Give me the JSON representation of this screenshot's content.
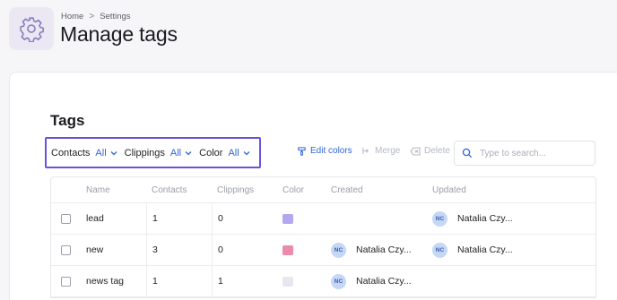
{
  "breadcrumb": {
    "home": "Home",
    "separator": ">",
    "current": "Settings"
  },
  "page": {
    "title": "Manage tags",
    "icon": "gear-icon"
  },
  "card": {
    "title": "Tags"
  },
  "filters": [
    {
      "label": "Contacts",
      "value": "All"
    },
    {
      "label": "Clippings",
      "value": "All"
    },
    {
      "label": "Color",
      "value": "All"
    }
  ],
  "toolbar": {
    "edit_colors": "Edit colors",
    "merge": "Merge",
    "delete": "Delete"
  },
  "search": {
    "placeholder": "Type to search..."
  },
  "table": {
    "columns": [
      "Name",
      "Contacts",
      "Clippings",
      "Color",
      "Created",
      "Updated"
    ],
    "rows": [
      {
        "name": "lead",
        "contacts": "1",
        "clippings": "0",
        "color": "#b4a6ef",
        "created_initials": "",
        "created_by": "",
        "updated_initials": "NC",
        "updated_by": "Natalia Czy..."
      },
      {
        "name": "new",
        "contacts": "3",
        "clippings": "0",
        "color": "#ec8aa9",
        "created_initials": "NC",
        "created_by": "Natalia Czy...",
        "updated_initials": "NC",
        "updated_by": "Natalia Czy..."
      },
      {
        "name": "news tag",
        "contacts": "1",
        "clippings": "1",
        "color": "#e9e6f1",
        "created_initials": "NC",
        "created_by": "Natalia Czy...",
        "updated_initials": "",
        "updated_by": ""
      }
    ]
  },
  "colors": {
    "accent": "#2f64d8",
    "focus_outline": "#6b52d8",
    "avatar_bg": "#c5d7f6"
  }
}
